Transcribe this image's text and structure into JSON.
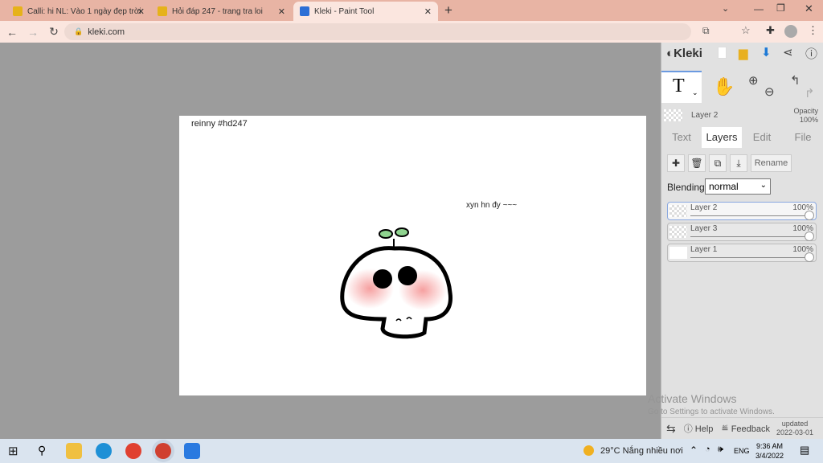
{
  "browser": {
    "tabs": [
      {
        "title": "Calli: hi NL: Vào 1 ngày đẹp trời",
        "active": false
      },
      {
        "title": "Hỏi đáp 247 - trang tra loi",
        "active": false
      },
      {
        "title": "Kleki - Paint Tool",
        "active": true
      }
    ],
    "url": "kleki.com"
  },
  "canvas": {
    "text1": "reinny #hd247",
    "text2": "xyn hn đy ~~~"
  },
  "panel": {
    "logo": "Kleki",
    "current_layer": "Layer 2",
    "opacity_label": "Opacity",
    "opacity_value": "100%",
    "tabs": [
      "Text",
      "Layers",
      "Edit",
      "File"
    ],
    "active_tab": "Layers",
    "rename": "Rename",
    "blending_label": "Blending",
    "blending_value": "normal",
    "layers": [
      {
        "name": "Layer 2",
        "opacity": "100%",
        "selected": true
      },
      {
        "name": "Layer 3",
        "opacity": "100%"
      },
      {
        "name": "Layer 1",
        "opacity": "100%"
      }
    ],
    "help": "Help",
    "feedback": "Feedback",
    "updated_label": "updated",
    "updated_date": "2022-03-01"
  },
  "watermark": {
    "title": "Activate Windows",
    "sub": "Go to Settings to activate Windows."
  },
  "taskbar": {
    "weather": "29°C  Nắng nhiều nơi",
    "lang": "ENG",
    "time": "9:36 AM",
    "date": "3/4/2022"
  }
}
